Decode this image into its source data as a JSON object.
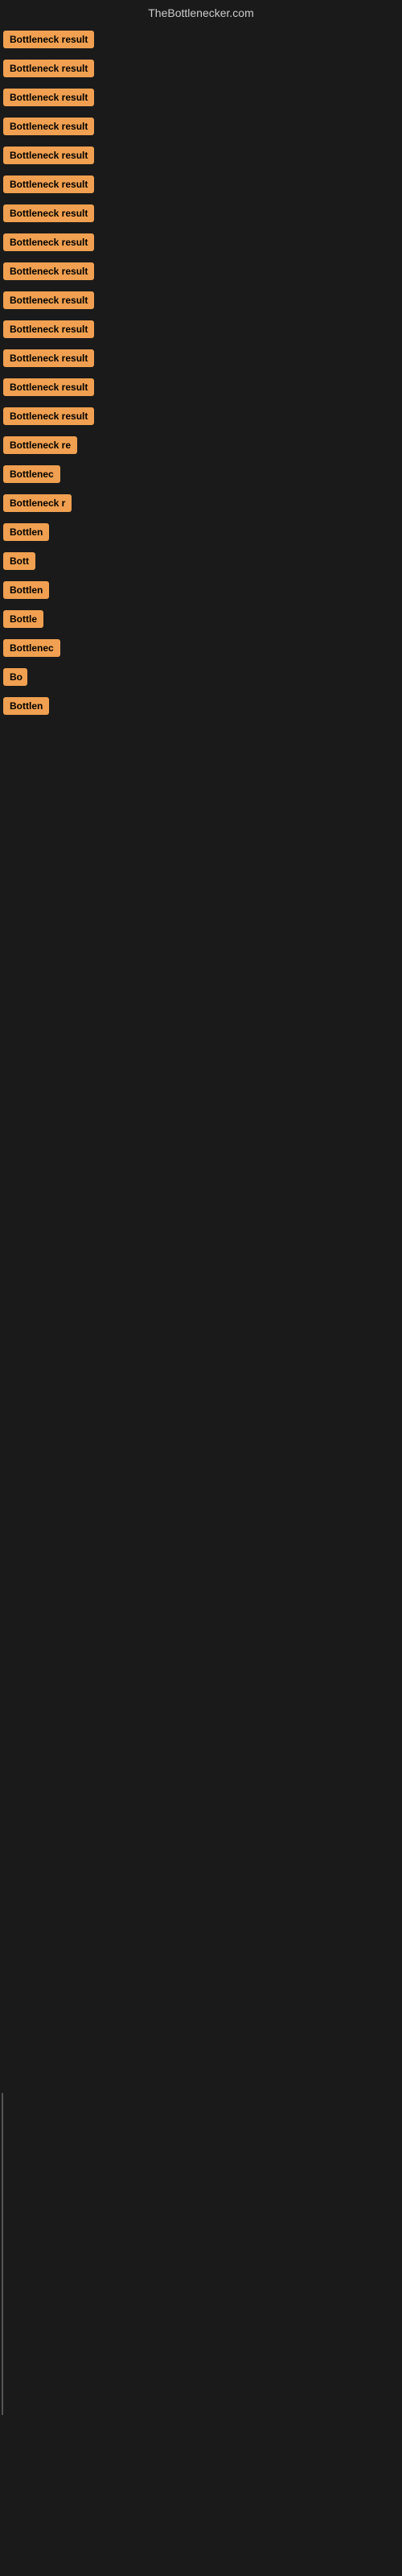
{
  "site": {
    "title": "TheBottlenecker.com"
  },
  "items": [
    {
      "id": 1,
      "label": "Bottleneck result",
      "width": 120
    },
    {
      "id": 2,
      "label": "Bottleneck result",
      "width": 120
    },
    {
      "id": 3,
      "label": "Bottleneck result",
      "width": 120
    },
    {
      "id": 4,
      "label": "Bottleneck result",
      "width": 120
    },
    {
      "id": 5,
      "label": "Bottleneck result",
      "width": 120
    },
    {
      "id": 6,
      "label": "Bottleneck result",
      "width": 120
    },
    {
      "id": 7,
      "label": "Bottleneck result",
      "width": 120
    },
    {
      "id": 8,
      "label": "Bottleneck result",
      "width": 120
    },
    {
      "id": 9,
      "label": "Bottleneck result",
      "width": 120
    },
    {
      "id": 10,
      "label": "Bottleneck result",
      "width": 120
    },
    {
      "id": 11,
      "label": "Bottleneck result",
      "width": 120
    },
    {
      "id": 12,
      "label": "Bottleneck result",
      "width": 120
    },
    {
      "id": 13,
      "label": "Bottleneck result",
      "width": 120
    },
    {
      "id": 14,
      "label": "Bottleneck result",
      "width": 120
    },
    {
      "id": 15,
      "label": "Bottleneck re",
      "width": 100
    },
    {
      "id": 16,
      "label": "Bottlenec",
      "width": 82
    },
    {
      "id": 17,
      "label": "Bottleneck r",
      "width": 90
    },
    {
      "id": 18,
      "label": "Bottlen",
      "width": 72
    },
    {
      "id": 19,
      "label": "Bott",
      "width": 46
    },
    {
      "id": 20,
      "label": "Bottlen",
      "width": 72
    },
    {
      "id": 21,
      "label": "Bottle",
      "width": 60
    },
    {
      "id": 22,
      "label": "Bottlenec",
      "width": 82
    },
    {
      "id": 23,
      "label": "Bo",
      "width": 30
    },
    {
      "id": 24,
      "label": "Bottlen",
      "width": 72
    }
  ]
}
